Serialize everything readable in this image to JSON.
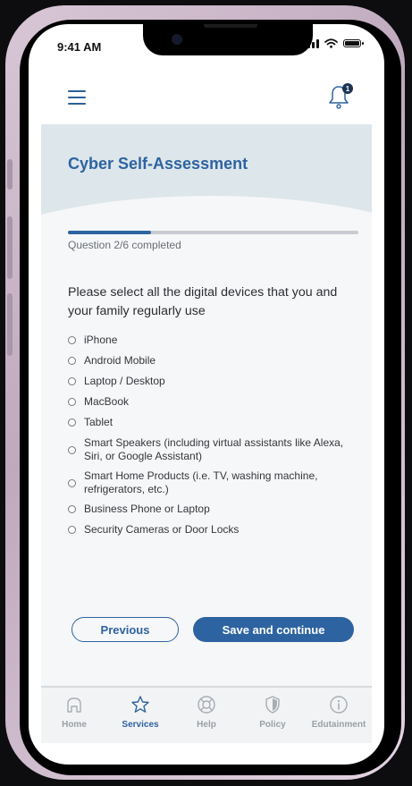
{
  "status_bar": {
    "time": "9:41 AM"
  },
  "header": {
    "notification_count": "1"
  },
  "assessment": {
    "title": "Cyber Self-Assessment",
    "progress_fraction": 0.2857,
    "progress_text": "Question 2/6 completed",
    "question": "Please select all the digital devices that you and your family regularly use",
    "options": [
      "iPhone",
      "Android Mobile",
      "Laptop / Desktop",
      "MacBook",
      "Tablet",
      "Smart Speakers (including virtual assistants like Alexa, Siri, or Google Assistant)",
      "Smart Home Products (i.e. TV, washing machine, refrigerators, etc.)",
      "Business Phone or Laptop",
      "Security Cameras or Door Locks"
    ]
  },
  "actions": {
    "previous_label": "Previous",
    "save_label": "Save and continue"
  },
  "nav": {
    "items": [
      {
        "label": "Home",
        "icon": "home-icon"
      },
      {
        "label": "Services",
        "icon": "star-icon",
        "active": true
      },
      {
        "label": "Help",
        "icon": "help-icon"
      },
      {
        "label": "Policy",
        "icon": "shield-icon"
      },
      {
        "label": "Edutainment",
        "icon": "info-icon"
      }
    ]
  },
  "colors": {
    "accent": "#2e63a1",
    "hero_bg": "#dde6ea",
    "badge": "#1d3352"
  }
}
